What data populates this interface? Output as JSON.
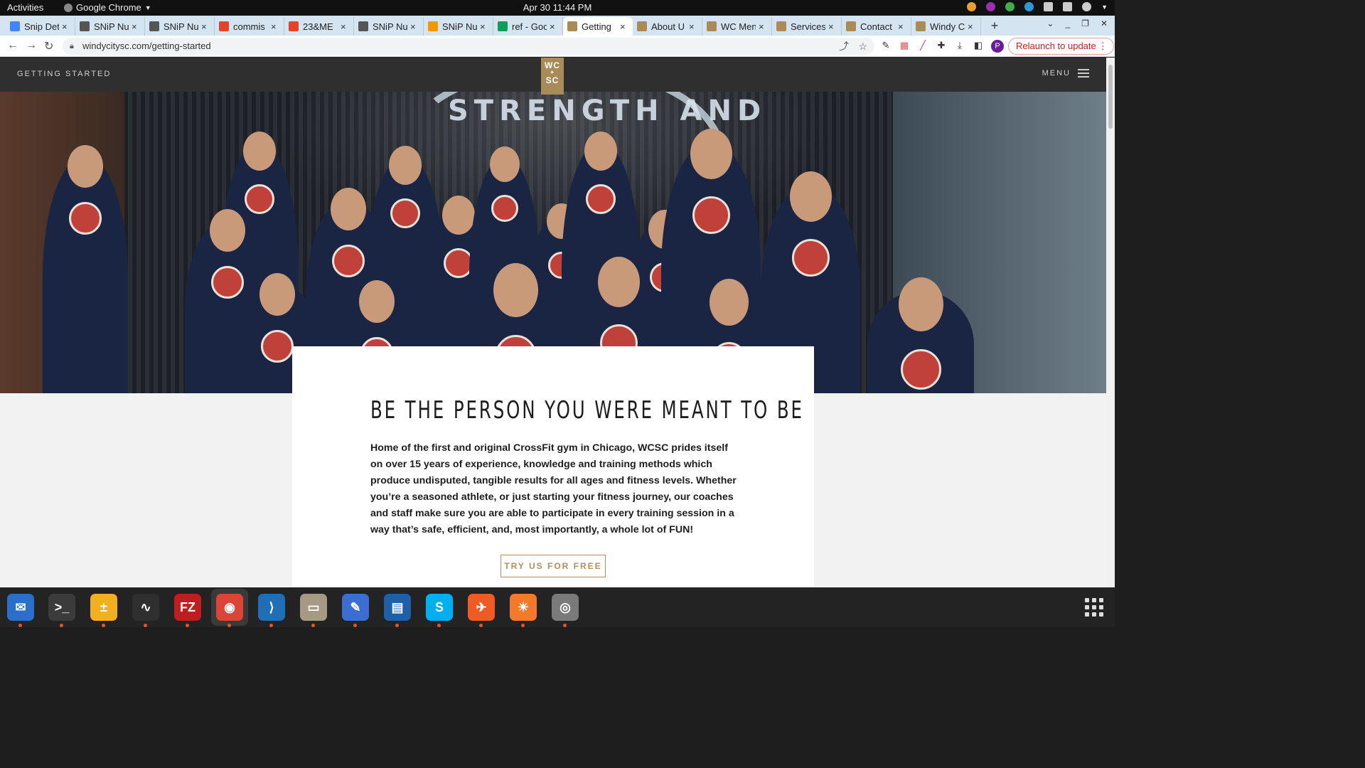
{
  "topbar": {
    "activities": "Activities",
    "app_name": "Google Chrome",
    "clock": "Apr 30  11:44 PM"
  },
  "tabs": [
    {
      "title": "Snip Det",
      "icon": "docs-icon",
      "color": "#4285f4"
    },
    {
      "title": "SNiP Nu",
      "icon": "snip-icon",
      "color": "#555555"
    },
    {
      "title": "SNiP Nu",
      "icon": "snip-icon",
      "color": "#555555"
    },
    {
      "title": "commis",
      "icon": "gitlab-icon",
      "color": "#e24329"
    },
    {
      "title": "23&ME",
      "icon": "gitlab-icon",
      "color": "#e24329"
    },
    {
      "title": "SNiP Nu",
      "icon": "snip-icon",
      "color": "#555555"
    },
    {
      "title": "SNiP Nu",
      "icon": "snip-icon",
      "color": "#f29900"
    },
    {
      "title": "ref - Goo",
      "icon": "sheets-icon",
      "color": "#0f9d58"
    },
    {
      "title": "Getting",
      "icon": "wcsc-icon",
      "color": "#a98b57",
      "active": true
    },
    {
      "title": "About U",
      "icon": "wcsc-icon",
      "color": "#a98b57"
    },
    {
      "title": "WC Men",
      "icon": "wcsc-icon",
      "color": "#a98b57"
    },
    {
      "title": "Services",
      "icon": "wcsc-icon",
      "color": "#a98b57"
    },
    {
      "title": "Contact",
      "icon": "wcsc-icon",
      "color": "#a98b57"
    },
    {
      "title": "Windy C",
      "icon": "wcsc-icon",
      "color": "#a98b57"
    }
  ],
  "omnibox": {
    "url": "windycitysc.com/getting-started",
    "relaunch_label": "Relaunch to update",
    "profile_initial": "P"
  },
  "site": {
    "nav_breadcrumb": "GETTING STARTED",
    "logo_line1": "WC",
    "logo_line2": "SC",
    "menu_label": "MENU",
    "hero_text": "STRENGTH AND",
    "headline": "BE THE PERSON YOU WERE MEANT TO BE",
    "body": "Home of the first and original CrossFit gym in Chicago, WCSC prides itself on over 15 years of experience, knowledge and training methods which produce undisputed, tangible results for all ages and fitness levels. Whether you’re a seasoned athlete, or just starting your fitness journey, our coaches and staff make sure you are able to participate in every training session in a way that’s safe, efficient, and, most importantly, a whole lot of FUN!",
    "cta_label": "TRY US FOR FREE"
  },
  "dock": [
    {
      "name": "thunderbird-icon",
      "color": "#2a6fc9",
      "glyph": "✉"
    },
    {
      "name": "terminal-icon",
      "color": "#3b3b3b",
      "glyph": ">_"
    },
    {
      "name": "calculator-icon",
      "color": "#f0b020",
      "glyph": "±"
    },
    {
      "name": "system-monitor-icon",
      "color": "#2f2f2f",
      "glyph": "∿"
    },
    {
      "name": "filezilla-icon",
      "color": "#bf1e1e",
      "glyph": "FZ"
    },
    {
      "name": "chrome-icon",
      "color": "#db4437",
      "glyph": "◉"
    },
    {
      "name": "vscode-icon",
      "color": "#1e6fb5",
      "glyph": "⟩"
    },
    {
      "name": "files-icon",
      "color": "#a69a85",
      "glyph": "▭"
    },
    {
      "name": "text-editor-icon",
      "color": "#3a6fd1",
      "glyph": "✎"
    },
    {
      "name": "document-viewer-icon",
      "color": "#1f5fa8",
      "glyph": "▤"
    },
    {
      "name": "skype-icon",
      "color": "#00aff0",
      "glyph": "S"
    },
    {
      "name": "postman-icon",
      "color": "#ef5b25",
      "glyph": "✈"
    },
    {
      "name": "blender-icon",
      "color": "#f5792a",
      "glyph": "☀"
    },
    {
      "name": "disk-icon",
      "color": "#7a7a7a",
      "glyph": "◎"
    }
  ]
}
